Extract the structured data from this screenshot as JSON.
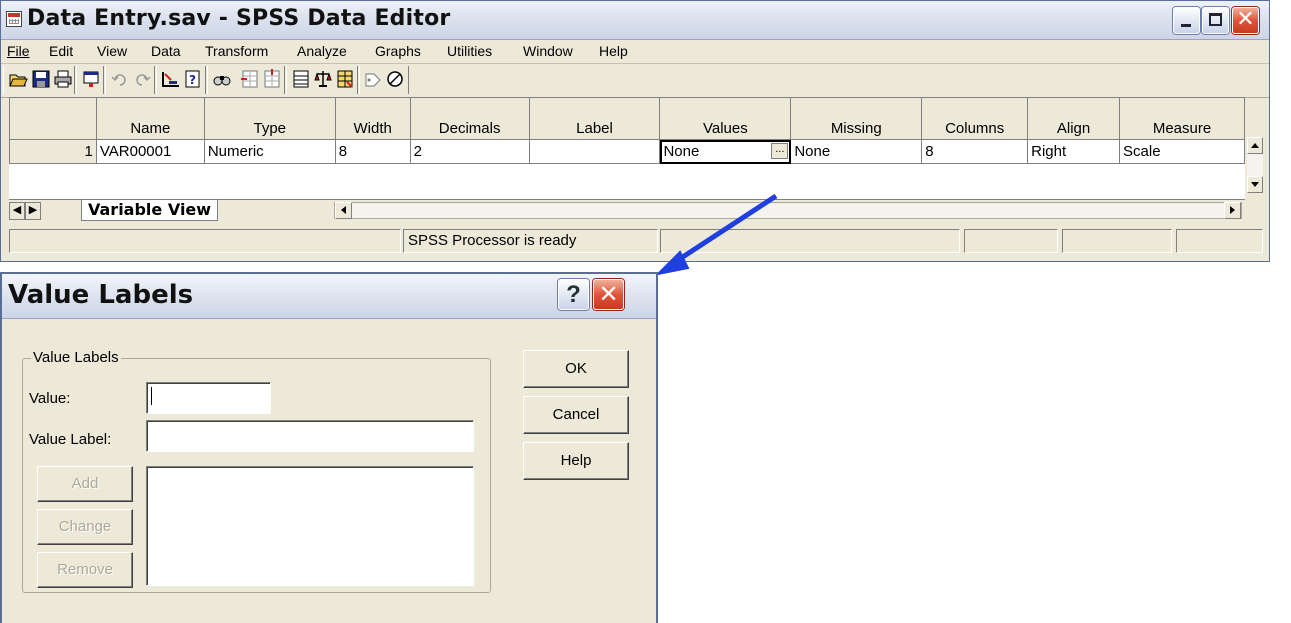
{
  "window": {
    "title": "Data Entry.sav - SPSS Data Editor",
    "caption_buttons": [
      "minimize",
      "maximize",
      "close"
    ]
  },
  "menubar": {
    "items": [
      {
        "label": "File"
      },
      {
        "label": "Edit"
      },
      {
        "label": "View"
      },
      {
        "label": "Data"
      },
      {
        "label": "Transform"
      },
      {
        "label": "Analyze"
      },
      {
        "label": "Graphs"
      },
      {
        "label": "Utilities"
      },
      {
        "label": "Window"
      },
      {
        "label": "Help"
      }
    ]
  },
  "toolbar": {
    "icons": [
      "open-icon",
      "save-icon",
      "print-icon",
      "dialog-recall-icon",
      "undo-icon",
      "redo-icon",
      "goto-case-icon",
      "variables-icon",
      "find-icon",
      "insert-cases-icon",
      "insert-variable-icon",
      "split-file-icon",
      "weight-cases-icon",
      "select-cases-icon",
      "value-labels-icon",
      "use-sets-icon"
    ]
  },
  "grid": {
    "columns": [
      "Name",
      "Type",
      "Width",
      "Decimals",
      "Label",
      "Values",
      "Missing",
      "Columns",
      "Align",
      "Measure"
    ],
    "rows": [
      {
        "num": "1",
        "name": "VAR00001",
        "type": "Numeric",
        "width": "8",
        "decimals": "2",
        "label": "",
        "values": "None",
        "missing": "None",
        "columns": "8",
        "align": "Right",
        "measure": "Scale"
      }
    ]
  },
  "tabs": {
    "active": "Variable View"
  },
  "status": {
    "processor": "SPSS Processor  is ready"
  },
  "dialog": {
    "title": "Value Labels",
    "group_label": "Value Labels",
    "value_label": "Value:",
    "value_label_label": "Value Label:",
    "value_input": "",
    "value_label_input": "",
    "buttons": {
      "ok": "OK",
      "cancel": "Cancel",
      "help": "Help",
      "add": "Add",
      "change": "Change",
      "remove": "Remove"
    }
  },
  "colors": {
    "arrow": "#1f3fe0",
    "close_button": "#e0553a",
    "window_face": "#ece9d8"
  }
}
